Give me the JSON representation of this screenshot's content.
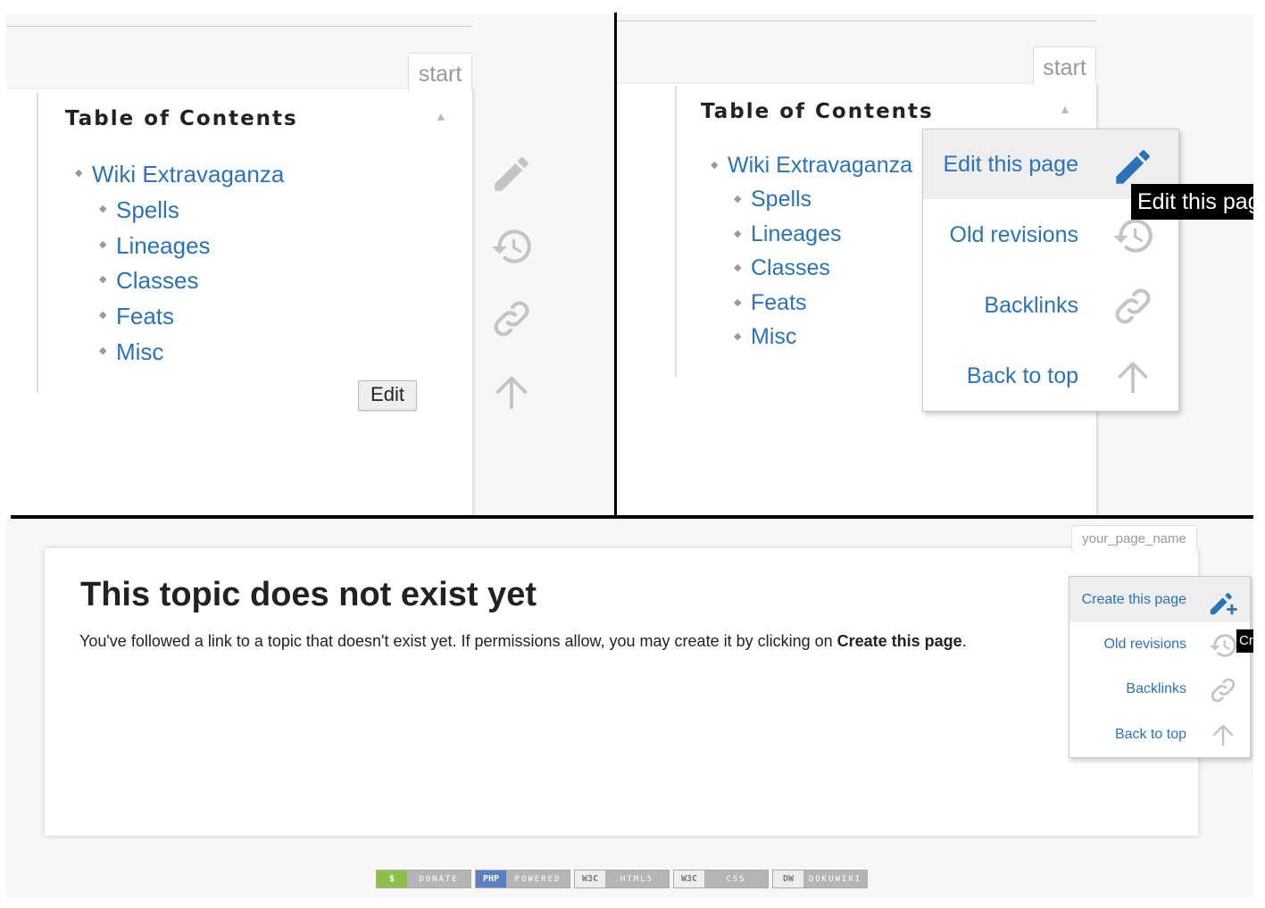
{
  "colors": {
    "link": "#2b73b7",
    "icon_gray": "#c4c4c4",
    "icon_active": "#2b73b7",
    "menu_active_bg": "#eeeeee",
    "tooltip_bg": "#000000",
    "divider": "#000000"
  },
  "panel_left": {
    "page_tab": "start",
    "toc": {
      "title": "Table of Contents",
      "toggle_icon": "triangle-up-icon",
      "items": [
        {
          "label": "Wiki Extravaganza",
          "level": 1
        },
        {
          "label": "Spells",
          "level": 2
        },
        {
          "label": "Lineages",
          "level": 2
        },
        {
          "label": "Classes",
          "level": 2
        },
        {
          "label": "Feats",
          "level": 2
        },
        {
          "label": "Misc",
          "level": 2
        }
      ]
    },
    "edit_button": "Edit",
    "pagetools_icons": [
      "pencil-icon",
      "history-icon",
      "link-icon",
      "arrow-up-icon"
    ]
  },
  "panel_right": {
    "page_tab": "start",
    "toc": {
      "title": "Table of Contents",
      "toggle_icon": "triangle-up-icon",
      "items": [
        {
          "label": "Wiki Extravaganza",
          "level": 1
        },
        {
          "label": "Spells",
          "level": 2
        },
        {
          "label": "Lineages",
          "level": 2
        },
        {
          "label": "Classes",
          "level": 2
        },
        {
          "label": "Feats",
          "level": 2
        },
        {
          "label": "Misc",
          "level": 2
        }
      ]
    },
    "pagetools_menu": [
      {
        "label": "Edit this page",
        "icon": "pencil-icon",
        "active": true
      },
      {
        "label": "Old revisions",
        "icon": "history-icon",
        "active": false
      },
      {
        "label": "Backlinks",
        "icon": "link-icon",
        "active": false
      },
      {
        "label": "Back to top",
        "icon": "arrow-up-icon",
        "active": false
      }
    ],
    "tooltip": "Edit this pag"
  },
  "panel_bottom": {
    "page_tab": "your_page_name",
    "heading": "This topic does not exist yet",
    "body_before": "You've followed a link to a topic that doesn't exist yet. If permissions allow, you may create it by clicking on ",
    "body_bold": "Create this page",
    "body_after": ".",
    "pagetools_menu": [
      {
        "label": "Create this page",
        "icon": "pencil-plus-icon",
        "active": true
      },
      {
        "label": "Old revisions",
        "icon": "history-icon",
        "active": false
      },
      {
        "label": "Backlinks",
        "icon": "link-icon",
        "active": false
      },
      {
        "label": "Back to top",
        "icon": "arrow-up-icon",
        "active": false
      }
    ],
    "tooltip": "Cr",
    "footer_badges": [
      {
        "left": "$",
        "right": "DONATE",
        "left_color": "#8cc04a"
      },
      {
        "left": "PHP",
        "right": "POWERED",
        "left_color": "#5a7fc2"
      },
      {
        "left": "W3C",
        "right": "HTML5",
        "left_color": "#b5b5b5"
      },
      {
        "left": "W3C",
        "right": "CSS",
        "left_color": "#b5b5b5"
      },
      {
        "left": "DW",
        "right": "DOKUWIKI",
        "left_color": "#b5b5b5"
      }
    ]
  }
}
